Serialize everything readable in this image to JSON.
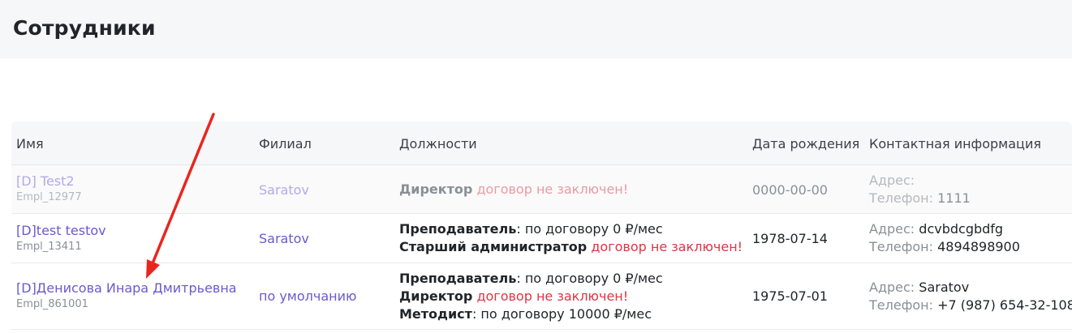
{
  "page": {
    "title": "Сотрудники"
  },
  "table": {
    "headers": [
      "Имя",
      "Филиал",
      "Должности",
      "Дата рождения",
      "Контактная информация"
    ],
    "rows": [
      {
        "name": "[D] Test2",
        "id": "Empl_12977",
        "branch": "Saratov",
        "positions": [
          {
            "title": "Директор",
            "detail": "договор не заключен!",
            "separator": " "
          }
        ],
        "birth_date": "0000-00-00",
        "address_label": "Адрес:",
        "address": "",
        "phone_label": "Телефон:",
        "phone": "1111"
      },
      {
        "name": "[D]test testov",
        "id": "Empl_13411",
        "branch": "Saratov",
        "positions": [
          {
            "title": "Преподаватель",
            "detail": "по договору 0 ₽/мес",
            "separator": ": "
          },
          {
            "title": "Старший администратор",
            "detail": "договор не заключен!",
            "separator": " "
          }
        ],
        "birth_date": "1978-07-14",
        "address_label": "Адрес:",
        "address": "dcvbdcgbdfg",
        "phone_label": "Телефон:",
        "phone": "4894898900"
      },
      {
        "name": "[D]Денисова Инара Дмитрьевна",
        "id": "Empl_861001",
        "branch": "по умолчанию",
        "positions": [
          {
            "title": "Преподаватель",
            "detail": "по договору 0 ₽/мес",
            "separator": ": "
          },
          {
            "title": "Директор",
            "detail": "договор не заключен!",
            "separator": " "
          },
          {
            "title": "Методист",
            "detail": "по договору 10000 ₽/мес",
            "separator": ": "
          }
        ],
        "birth_date": "1975-07-01",
        "address_label": "Адрес:",
        "address": "Saratov",
        "phone_label": "Телефон:",
        "phone": "+7 (987) 654-32-108"
      }
    ]
  },
  "annotation": {
    "arrow_color": "#e8261f"
  }
}
